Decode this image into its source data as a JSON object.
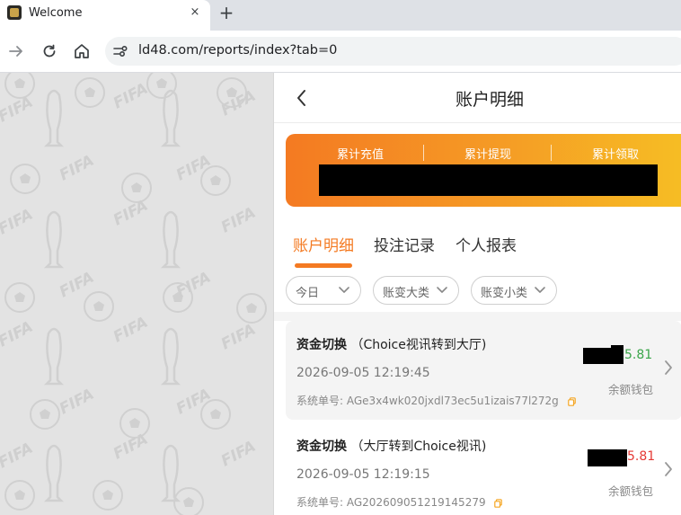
{
  "browser": {
    "tab_title": "Welcome",
    "tab_close": "×",
    "new_tab": "+",
    "url": "ld48.com/reports/index?tab=0"
  },
  "background": {
    "watermark_text": "FIFA"
  },
  "header": {
    "title": "账户明细"
  },
  "summary": {
    "labels": [
      "累计充值",
      "累计提现",
      "累计领取"
    ],
    "colors": {
      "start": "#f47a22",
      "end": "#f6c024"
    }
  },
  "tabs": [
    {
      "label": "账户明细",
      "active": true
    },
    {
      "label": "投注记录",
      "active": false
    },
    {
      "label": "个人报表",
      "active": false
    }
  ],
  "filters": [
    {
      "label": "今日"
    },
    {
      "label": "账变大类"
    },
    {
      "label": "账变小类"
    }
  ],
  "records": [
    {
      "type": "资金切换",
      "detail": "（Choice视讯转到大厅)",
      "time": "2026-09-05 12:19:45",
      "order_label": "系统单号:",
      "order_no": "AGe3x4wk020jxdl73ec5u1izais77l272g",
      "amount_visible": "5.81",
      "amount_color": "#3aa54a",
      "wallet": "余额钱包"
    },
    {
      "type": "资金切换",
      "detail": "（大厅转到Choice视讯)",
      "time": "2026-09-05 12:19:15",
      "order_label": "系统单号:",
      "order_no": "AG202609051219145279",
      "amount_visible": "5.81",
      "amount_color": "#e53935",
      "wallet": "余额钱包"
    }
  ],
  "colors": {
    "accent": "#f47a22",
    "positive": "#3aa54a",
    "negative": "#e53935"
  }
}
